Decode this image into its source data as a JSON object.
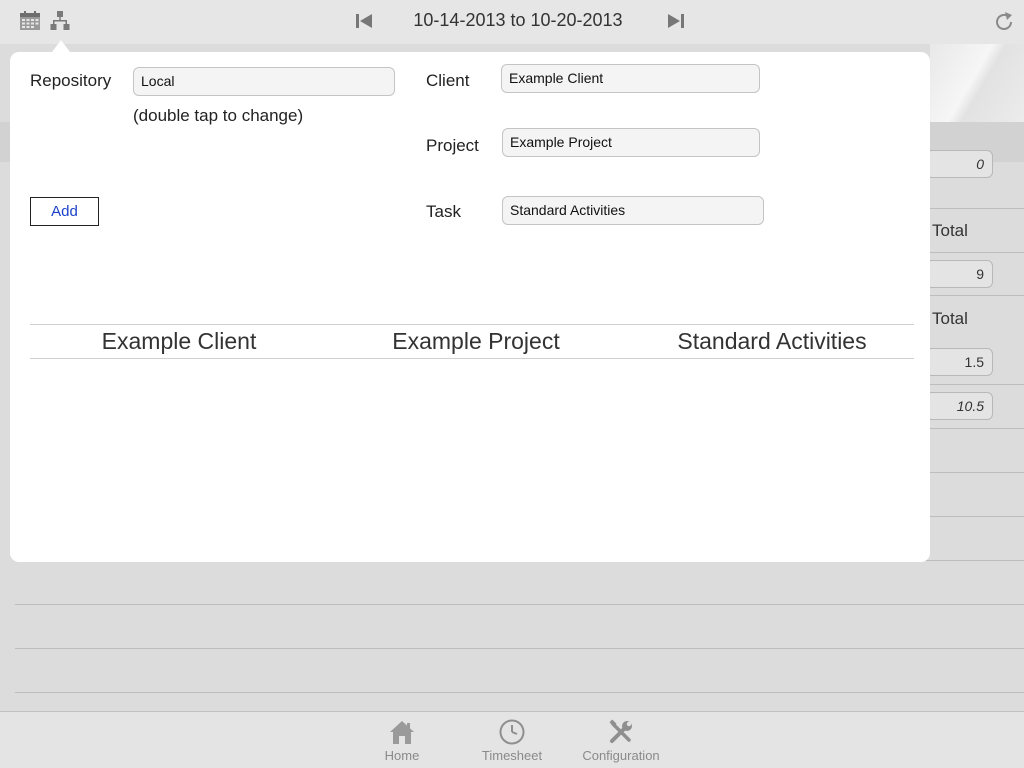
{
  "header": {
    "date_range": "10-14-2013 to 10-20-2013",
    "icons": [
      "calendar-icon",
      "hierarchy-icon",
      "skip-back-icon",
      "skip-forward-icon",
      "refresh-icon"
    ]
  },
  "background": {
    "field_values": [
      "0",
      "9",
      "1.5",
      "10.5"
    ],
    "total_labels": [
      "Total",
      "Total"
    ]
  },
  "popover": {
    "repository_label": "Repository",
    "repository_value": "Local",
    "repository_hint": "(double tap to change)",
    "client_label": "Client",
    "client_value": "Example Client",
    "project_label": "Project",
    "project_value": "Example Project",
    "task_label": "Task",
    "task_value": "Standard Activities",
    "add_label": "Add",
    "assignment": {
      "client": "Example Client",
      "project": "Example Project",
      "task": "Standard Activities"
    }
  },
  "tabbar": {
    "tabs": [
      {
        "label": "Home",
        "icon": "house-icon"
      },
      {
        "label": "Timesheet",
        "icon": "clock-icon"
      },
      {
        "label": "Configuration",
        "icon": "tools-icon"
      }
    ]
  },
  "colors": {
    "link_blue": "#1a3fc9",
    "tab_gray": "#8a8a8a"
  }
}
